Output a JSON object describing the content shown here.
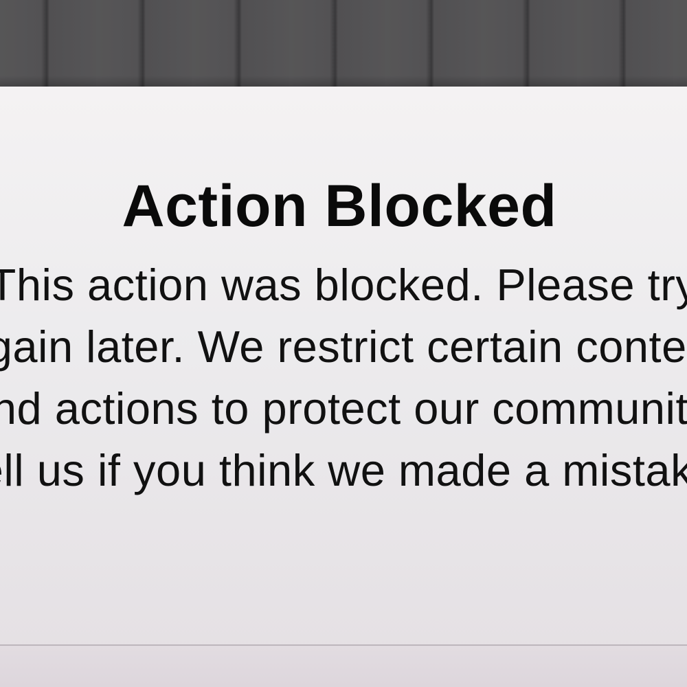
{
  "alert": {
    "title": "Action Blocked",
    "message": "This action was blocked. Please try again later. We restrict certain content and actions to protect our community. Tell us if you think we made a mistake."
  }
}
